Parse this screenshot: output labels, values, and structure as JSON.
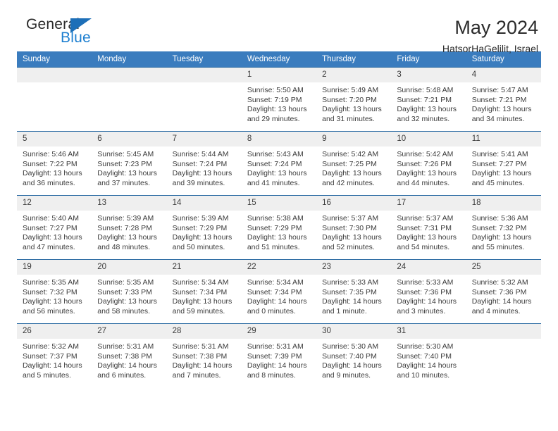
{
  "brand": {
    "name_top": "General",
    "name_bottom": "Blue"
  },
  "header": {
    "month_title": "May 2024",
    "location": "HatsorHaGelilit, Israel"
  },
  "theme": {
    "header_blue": "#3a7cbe",
    "row_rule_blue": "#2e6da4",
    "daynum_bg": "#efefef",
    "logo_blue": "#1d7fd0",
    "text": "#3b3b3b"
  },
  "weekdays": [
    "Sunday",
    "Monday",
    "Tuesday",
    "Wednesday",
    "Thursday",
    "Friday",
    "Saturday"
  ],
  "weeks": [
    [
      {
        "day": "",
        "sunrise": "",
        "sunset": "",
        "daylight": "",
        "empty": true
      },
      {
        "day": "",
        "sunrise": "",
        "sunset": "",
        "daylight": "",
        "empty": true
      },
      {
        "day": "",
        "sunrise": "",
        "sunset": "",
        "daylight": "",
        "empty": true
      },
      {
        "day": "1",
        "sunrise": "Sunrise: 5:50 AM",
        "sunset": "Sunset: 7:19 PM",
        "daylight": "Daylight: 13 hours and 29 minutes."
      },
      {
        "day": "2",
        "sunrise": "Sunrise: 5:49 AM",
        "sunset": "Sunset: 7:20 PM",
        "daylight": "Daylight: 13 hours and 31 minutes."
      },
      {
        "day": "3",
        "sunrise": "Sunrise: 5:48 AM",
        "sunset": "Sunset: 7:21 PM",
        "daylight": "Daylight: 13 hours and 32 minutes."
      },
      {
        "day": "4",
        "sunrise": "Sunrise: 5:47 AM",
        "sunset": "Sunset: 7:21 PM",
        "daylight": "Daylight: 13 hours and 34 minutes."
      }
    ],
    [
      {
        "day": "5",
        "sunrise": "Sunrise: 5:46 AM",
        "sunset": "Sunset: 7:22 PM",
        "daylight": "Daylight: 13 hours and 36 minutes."
      },
      {
        "day": "6",
        "sunrise": "Sunrise: 5:45 AM",
        "sunset": "Sunset: 7:23 PM",
        "daylight": "Daylight: 13 hours and 37 minutes."
      },
      {
        "day": "7",
        "sunrise": "Sunrise: 5:44 AM",
        "sunset": "Sunset: 7:24 PM",
        "daylight": "Daylight: 13 hours and 39 minutes."
      },
      {
        "day": "8",
        "sunrise": "Sunrise: 5:43 AM",
        "sunset": "Sunset: 7:24 PM",
        "daylight": "Daylight: 13 hours and 41 minutes."
      },
      {
        "day": "9",
        "sunrise": "Sunrise: 5:42 AM",
        "sunset": "Sunset: 7:25 PM",
        "daylight": "Daylight: 13 hours and 42 minutes."
      },
      {
        "day": "10",
        "sunrise": "Sunrise: 5:42 AM",
        "sunset": "Sunset: 7:26 PM",
        "daylight": "Daylight: 13 hours and 44 minutes."
      },
      {
        "day": "11",
        "sunrise": "Sunrise: 5:41 AM",
        "sunset": "Sunset: 7:27 PM",
        "daylight": "Daylight: 13 hours and 45 minutes."
      }
    ],
    [
      {
        "day": "12",
        "sunrise": "Sunrise: 5:40 AM",
        "sunset": "Sunset: 7:27 PM",
        "daylight": "Daylight: 13 hours and 47 minutes."
      },
      {
        "day": "13",
        "sunrise": "Sunrise: 5:39 AM",
        "sunset": "Sunset: 7:28 PM",
        "daylight": "Daylight: 13 hours and 48 minutes."
      },
      {
        "day": "14",
        "sunrise": "Sunrise: 5:39 AM",
        "sunset": "Sunset: 7:29 PM",
        "daylight": "Daylight: 13 hours and 50 minutes."
      },
      {
        "day": "15",
        "sunrise": "Sunrise: 5:38 AM",
        "sunset": "Sunset: 7:29 PM",
        "daylight": "Daylight: 13 hours and 51 minutes."
      },
      {
        "day": "16",
        "sunrise": "Sunrise: 5:37 AM",
        "sunset": "Sunset: 7:30 PM",
        "daylight": "Daylight: 13 hours and 52 minutes."
      },
      {
        "day": "17",
        "sunrise": "Sunrise: 5:37 AM",
        "sunset": "Sunset: 7:31 PM",
        "daylight": "Daylight: 13 hours and 54 minutes."
      },
      {
        "day": "18",
        "sunrise": "Sunrise: 5:36 AM",
        "sunset": "Sunset: 7:32 PM",
        "daylight": "Daylight: 13 hours and 55 minutes."
      }
    ],
    [
      {
        "day": "19",
        "sunrise": "Sunrise: 5:35 AM",
        "sunset": "Sunset: 7:32 PM",
        "daylight": "Daylight: 13 hours and 56 minutes."
      },
      {
        "day": "20",
        "sunrise": "Sunrise: 5:35 AM",
        "sunset": "Sunset: 7:33 PM",
        "daylight": "Daylight: 13 hours and 58 minutes."
      },
      {
        "day": "21",
        "sunrise": "Sunrise: 5:34 AM",
        "sunset": "Sunset: 7:34 PM",
        "daylight": "Daylight: 13 hours and 59 minutes."
      },
      {
        "day": "22",
        "sunrise": "Sunrise: 5:34 AM",
        "sunset": "Sunset: 7:34 PM",
        "daylight": "Daylight: 14 hours and 0 minutes."
      },
      {
        "day": "23",
        "sunrise": "Sunrise: 5:33 AM",
        "sunset": "Sunset: 7:35 PM",
        "daylight": "Daylight: 14 hours and 1 minute."
      },
      {
        "day": "24",
        "sunrise": "Sunrise: 5:33 AM",
        "sunset": "Sunset: 7:36 PM",
        "daylight": "Daylight: 14 hours and 3 minutes."
      },
      {
        "day": "25",
        "sunrise": "Sunrise: 5:32 AM",
        "sunset": "Sunset: 7:36 PM",
        "daylight": "Daylight: 14 hours and 4 minutes."
      }
    ],
    [
      {
        "day": "26",
        "sunrise": "Sunrise: 5:32 AM",
        "sunset": "Sunset: 7:37 PM",
        "daylight": "Daylight: 14 hours and 5 minutes."
      },
      {
        "day": "27",
        "sunrise": "Sunrise: 5:31 AM",
        "sunset": "Sunset: 7:38 PM",
        "daylight": "Daylight: 14 hours and 6 minutes."
      },
      {
        "day": "28",
        "sunrise": "Sunrise: 5:31 AM",
        "sunset": "Sunset: 7:38 PM",
        "daylight": "Daylight: 14 hours and 7 minutes."
      },
      {
        "day": "29",
        "sunrise": "Sunrise: 5:31 AM",
        "sunset": "Sunset: 7:39 PM",
        "daylight": "Daylight: 14 hours and 8 minutes."
      },
      {
        "day": "30",
        "sunrise": "Sunrise: 5:30 AM",
        "sunset": "Sunset: 7:40 PM",
        "daylight": "Daylight: 14 hours and 9 minutes."
      },
      {
        "day": "31",
        "sunrise": "Sunrise: 5:30 AM",
        "sunset": "Sunset: 7:40 PM",
        "daylight": "Daylight: 14 hours and 10 minutes."
      },
      {
        "day": "",
        "sunrise": "",
        "sunset": "",
        "daylight": "",
        "empty": true
      }
    ]
  ]
}
